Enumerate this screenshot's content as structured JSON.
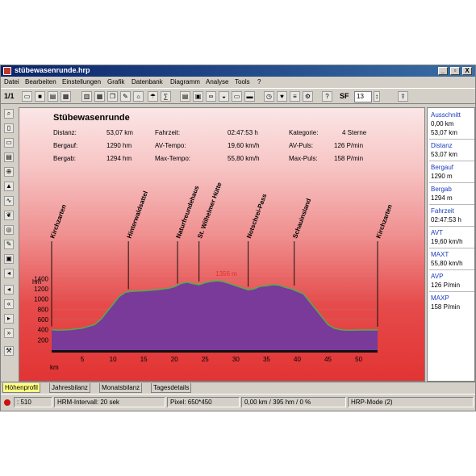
{
  "window": {
    "title": "stübewasenrunde.hrp",
    "buttons": [
      "_",
      "▫",
      "X"
    ]
  },
  "menu": [
    "Datei",
    "Bearbeiten",
    "Einstellungen",
    "Grafik",
    "Datenbank",
    "Diagramm",
    "Analyse",
    "Tools",
    "?"
  ],
  "toolbar": {
    "page_label": "1/1",
    "sf_label": "SF",
    "sf_value": "13",
    "icons": [
      "open-icon",
      "save-icon",
      "print-icon",
      "print-preview-icon",
      "table-icon",
      "grid-icon",
      "copy-icon",
      "tools-icon",
      "bulb-icon",
      "weather-icon",
      "calc-icon",
      "spreadsheet-icon",
      "notebook-icon",
      "bike-icon",
      "shoe-icon",
      "book-icon",
      "chart-icon",
      "stopwatch-icon",
      "heart-icon",
      "lap-icon",
      "settings-icon",
      "help-icon"
    ]
  },
  "left_tools": [
    "zoom-icon",
    "doc-icon",
    "monitor-icon",
    "print-icon",
    "zoom-in-icon",
    "chart-icon",
    "graph-icon",
    "leaf-icon",
    "globe-icon",
    "edit-icon",
    "disk-icon",
    "speaker-icon",
    "left-arrow-icon",
    "left-arrow2-icon",
    "right-arrow-icon",
    "right-arrow2-icon",
    "tools-icon"
  ],
  "summary": {
    "title": "Stübewasenrunde",
    "distanz_label": "Distanz:",
    "distanz_value": "53,07 km",
    "bergauf_label": "Bergauf:",
    "bergauf_value": "1290 hm",
    "bergab_label": "Bergab:",
    "bergab_value": "1294 hm",
    "fahrzeit_label": "Fahrzeit:",
    "fahrzeit_value": "02:47:53 h",
    "avtempo_label": "AV-Tempo:",
    "avtempo_value": "19,60 km/h",
    "maxtempo_label": "Max-Tempo:",
    "maxtempo_value": "55,80 km/h",
    "kategorie_label": "Kategorie:",
    "kategorie_value": "4 Sterne",
    "avpuls_label": "AV-Puls:",
    "avpuls_value": "126 P/min",
    "maxpuls_label": "Max-Puls:",
    "maxpuls_value": "158 P/min"
  },
  "right_panel": [
    {
      "label": "Ausschnitt",
      "values": [
        "0,00 km",
        "53,07 km"
      ]
    },
    {
      "label": "Distanz",
      "values": [
        "53,07 km"
      ]
    },
    {
      "label": "Bergauf",
      "values": [
        "1290 m"
      ]
    },
    {
      "label": "Bergab",
      "values": [
        "1294 m"
      ]
    },
    {
      "label": "Fahrzeit",
      "values": [
        "02:47:53 h"
      ]
    },
    {
      "label": "AVT",
      "values": [
        "19,60 km/h"
      ]
    },
    {
      "label": "MAXT",
      "values": [
        "55,80 km/h"
      ]
    },
    {
      "label": "AVP",
      "values": [
        "126 P/min"
      ]
    },
    {
      "label": "MAXP",
      "values": [
        "158 P/min"
      ]
    }
  ],
  "tabs": [
    "Höhenprofil",
    "Jahresbilanz",
    "Monatsbilanz",
    "Tagesdetails"
  ],
  "status": {
    "cell1": ": 510",
    "cell2": "HRM-Intervall: 20 sek",
    "cell3": "Pixel: 650*450",
    "cell4": "0,00 km / 395 hm / 0 %",
    "cell5": "HRP-Mode (2)"
  },
  "chart_data": {
    "type": "area",
    "xlabel": "km",
    "ylabel": "hm",
    "xlim": [
      0,
      53.07
    ],
    "ylim": [
      0,
      1500
    ],
    "x_ticks": [
      5,
      10,
      15,
      20,
      25,
      30,
      35,
      40,
      45,
      50
    ],
    "y_ticks": [
      200,
      400,
      600,
      800,
      1000,
      1200,
      1400
    ],
    "fill_color": "#7a3a9a",
    "line_color": "#4caf50",
    "max_label": "1356 m",
    "max_label_x": 28,
    "x": [
      0,
      1,
      3,
      5,
      7,
      8,
      9,
      10,
      11,
      12,
      13,
      15,
      17,
      19,
      20,
      21,
      22,
      23,
      24,
      25,
      26,
      27,
      28,
      29,
      30,
      31,
      32,
      33,
      34,
      35,
      36,
      37,
      38,
      39,
      40,
      41,
      42,
      43,
      44,
      45,
      46,
      47,
      48,
      49,
      50,
      51,
      52,
      53.07
    ],
    "y": [
      400,
      390,
      400,
      430,
      500,
      600,
      750,
      900,
      1050,
      1130,
      1150,
      1160,
      1180,
      1210,
      1240,
      1300,
      1330,
      1300,
      1280,
      1320,
      1345,
      1356,
      1340,
      1300,
      1260,
      1220,
      1180,
      1200,
      1250,
      1260,
      1280,
      1270,
      1230,
      1200,
      1150,
      1100,
      950,
      800,
      650,
      500,
      430,
      400,
      390,
      390,
      395,
      395,
      395,
      395
    ],
    "annotations": [
      {
        "label": "Kirchzarten",
        "x": 0
      },
      {
        "label": "Hinterwaldsattel",
        "x": 12.5
      },
      {
        "label": "Naturfreundehaus",
        "x": 20.5
      },
      {
        "label": "St. Wilhelmer Hütte",
        "x": 24
      },
      {
        "label": "Notschrei-Pass",
        "x": 32
      },
      {
        "label": "Schauinsland",
        "x": 39.5
      },
      {
        "label": "Kirchzarten",
        "x": 53.07
      }
    ]
  }
}
